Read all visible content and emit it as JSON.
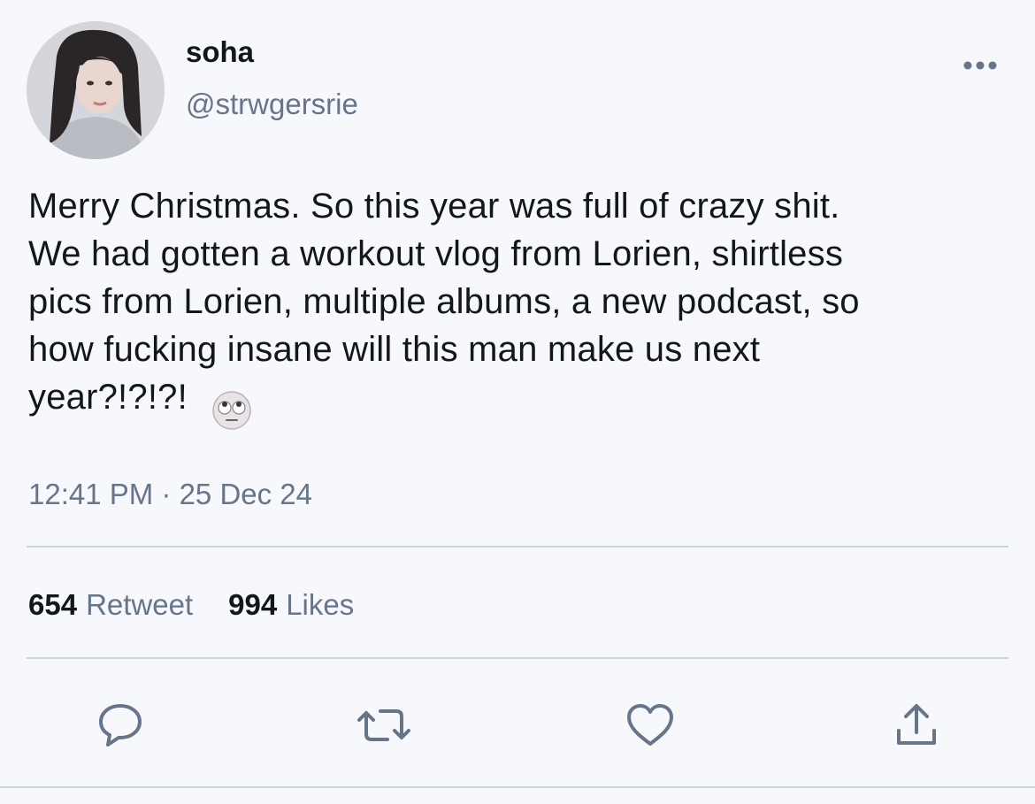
{
  "author": {
    "display_name": "soha",
    "handle": "@strwgersrie"
  },
  "tweet": {
    "text": " Merry Christmas. So this year was full of crazy shit.\nWe had gotten a workout vlog from Lorien, shirtless\npics from Lorien, multiple albums, a new podcast, so\nhow fucking insane will this man make us next\nyear?!?!?!",
    "emoji": "face-with-rolling-eyes",
    "timestamp": "12:41 PM · 25 Dec 24"
  },
  "stats": {
    "retweets": {
      "count": "654",
      "label": "Retweet"
    },
    "likes": {
      "count": "994",
      "label": "Likes"
    }
  },
  "actions": {
    "reply_icon": "speech-bubble-icon",
    "retweet_icon": "retweet-arrows-icon",
    "like_icon": "heart-icon",
    "share_icon": "share-upload-icon"
  },
  "colors": {
    "background": "#f7f8fc",
    "text": "#14171a",
    "secondary_text": "#66758a",
    "divider": "#ccd3dd"
  }
}
